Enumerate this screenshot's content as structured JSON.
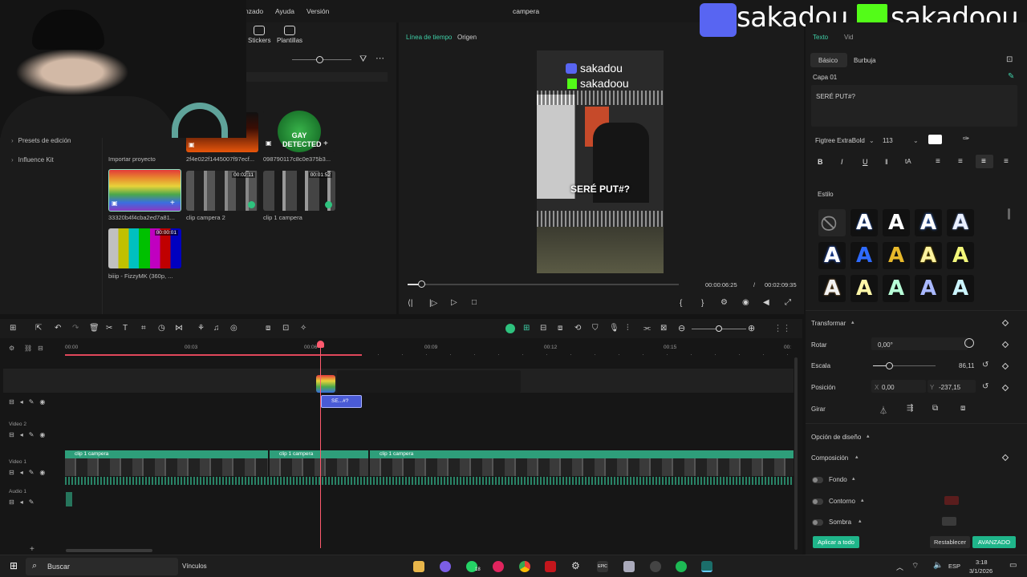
{
  "window": {
    "title": "campera",
    "menu": [
      "nzado",
      "Ayuda",
      "Versión"
    ]
  },
  "left_panel": {
    "toolbar": [
      {
        "label": "Stickers",
        "icon": "sticker-icon"
      },
      {
        "label": "Plantillas",
        "icon": "templates-icon"
      }
    ],
    "nav": [
      {
        "label": "Presets de edición"
      },
      {
        "label": "Influence Kit"
      }
    ],
    "media": [
      {
        "label": "Importar proyecto",
        "kind": "import"
      },
      {
        "label": "2f4e022f1445007f97ecf...",
        "kind": "fire"
      },
      {
        "label": "098790117c8c0e375b3...",
        "kind": "radar",
        "overlay": "GAY DETECTED"
      },
      {
        "label": "33320b4f4cba2ed7a81...",
        "kind": "rainbow"
      },
      {
        "label": "clip campera 2",
        "duration": "00:02:11",
        "kind": "bw"
      },
      {
        "label": "clip 1 campera",
        "duration": "00:01:52",
        "kind": "bw"
      },
      {
        "label": "biiip - FizzyMK (360p, ...",
        "duration": "00:00:01",
        "kind": "colorbars"
      }
    ]
  },
  "preview": {
    "tabs": [
      "Línea de tiempo",
      "Origen"
    ],
    "overlay_names": [
      "sakadou",
      "sakadoou"
    ],
    "caption": "SERÉ PUT#?",
    "current_time": "00:00:06:25",
    "separator": "/",
    "total_time": "00:02:09:35",
    "progress": 0.05
  },
  "brand_overlay": {
    "discord_name": "sakadou",
    "kick_name": "sakadoou"
  },
  "right_panel": {
    "tabs": [
      "Texto",
      "Vid"
    ],
    "subtabs": [
      "Básico",
      "Burbuja"
    ],
    "layer": "Capa 01",
    "text_value": "SERÉ PUT#?",
    "font": "Figtree ExtraBold",
    "size": "113",
    "style_section": "Estilo",
    "transform_section": "Transformar",
    "rotate_label": "Rotar",
    "rotate_value": "0,00°",
    "scale_label": "Escala",
    "scale_value": "86,11",
    "scale_fraction": 0.25,
    "position_label": "Posición",
    "pos_x_label": "X",
    "pos_x": "0,00",
    "pos_y_label": "Y",
    "pos_y": "-237,15",
    "flip_label": "Girar",
    "design_option": "Opción de diseño",
    "composition": "Composición",
    "background": "Fondo",
    "outline": "Contorno",
    "shadow": "Sombra",
    "apply_all": "Aplicar a todo",
    "reset": "Restablecer",
    "advanced": "AVANZADO",
    "accent_color": "#1fb58a"
  },
  "timeline": {
    "ticks": [
      "00:00",
      "00:03",
      "00:06",
      "00:09",
      "00:12",
      "00:15",
      "00:"
    ],
    "tracks": {
      "video2": "Video 2",
      "video1": "Video 1",
      "audio1": "Audio 1"
    },
    "clips": [
      {
        "label": "clip 1 campera"
      },
      {
        "label": "clip 1 campera"
      },
      {
        "label": "clip 1 campera"
      }
    ],
    "text_clip": "SE...#?"
  },
  "taskbar": {
    "search_label": "Buscar",
    "links_label": "Vínculos",
    "whatsapp_badge": "18",
    "lang": "ESP",
    "time": "3:18",
    "date": "3/1/2026"
  }
}
